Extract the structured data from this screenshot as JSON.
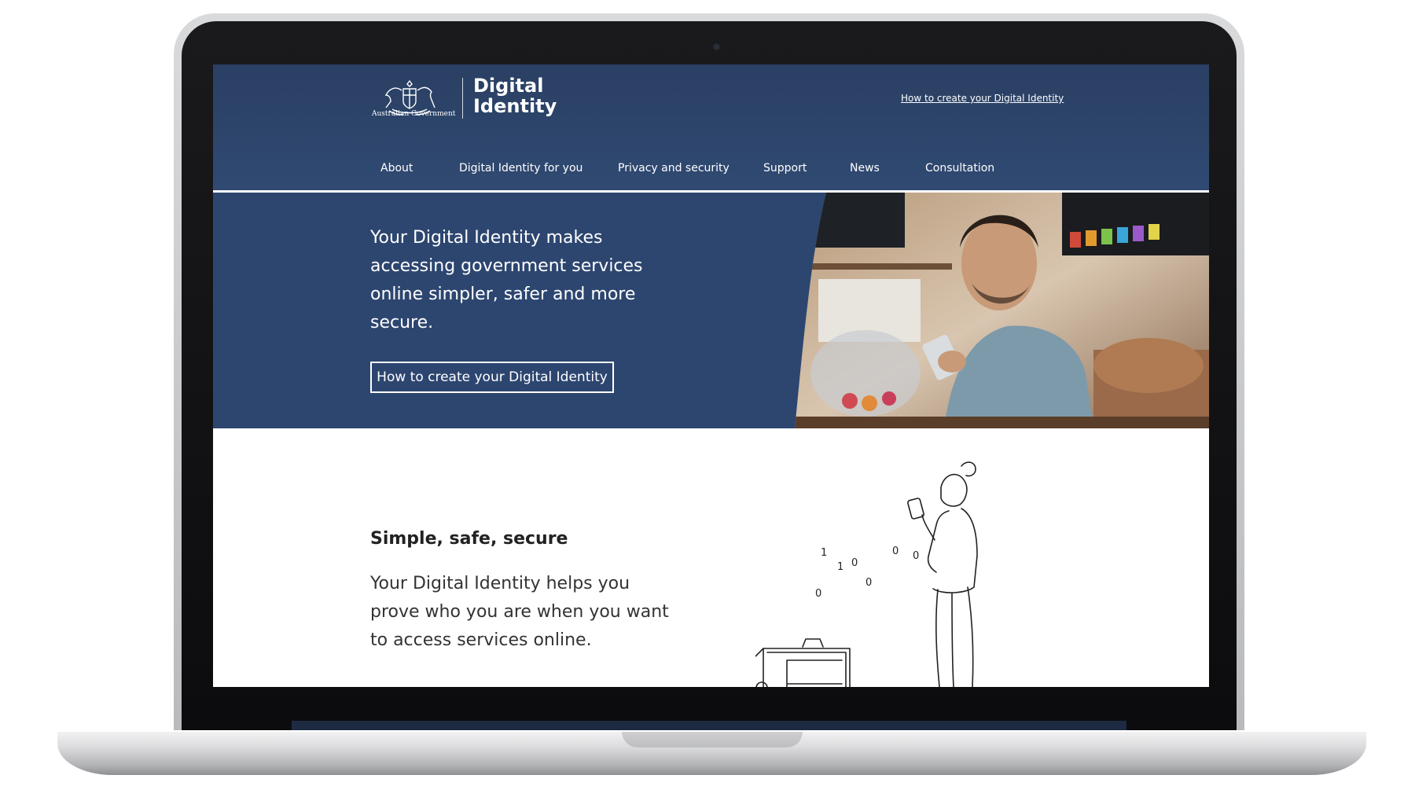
{
  "header": {
    "government_name": "Australian Government",
    "brand_line1": "Digital",
    "brand_line2": "Identity",
    "top_link": "How to create your Digital Identity"
  },
  "nav": {
    "items": [
      {
        "label": "About"
      },
      {
        "label": "Digital Identity for you"
      },
      {
        "label": "Privacy and security"
      },
      {
        "label": "Support"
      },
      {
        "label": "News"
      },
      {
        "label": "Consultation"
      }
    ]
  },
  "hero": {
    "text": "Your Digital Identity makes accessing government services online simpler, safer and more secure.",
    "button_label": "How to create your Digital Identity"
  },
  "section": {
    "heading": "Simple, safe, secure",
    "text": "Your Digital Identity helps you prove who you are when you want to access services online."
  },
  "colors": {
    "header_bg": "#2a3f63",
    "hero_bg": "#2d4670",
    "text_dark": "#222222"
  }
}
